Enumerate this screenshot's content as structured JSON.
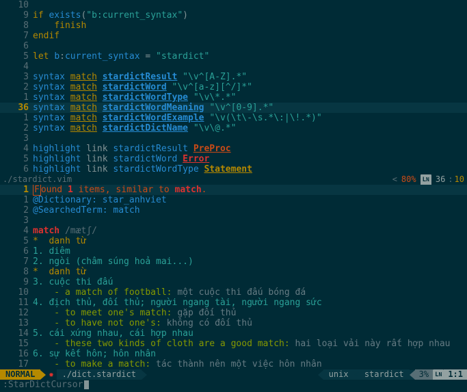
{
  "top_pane": {
    "filename": "./stardict.vim",
    "percent": "80%",
    "line": "36",
    "col": "10",
    "lines": [
      {
        "rel": "10",
        "cur": false,
        "tokens": []
      },
      {
        "rel": "9",
        "cur": false,
        "tokens": [
          {
            "t": "if ",
            "c": "yellow"
          },
          {
            "t": "exists",
            "c": "blue"
          },
          {
            "t": "(",
            "c": "base0"
          },
          {
            "t": "\"b:current_syntax\"",
            "c": "cyan"
          },
          {
            "t": ")",
            "c": "base0"
          }
        ]
      },
      {
        "rel": "8",
        "cur": false,
        "tokens": [
          {
            "t": "    ",
            "c": ""
          },
          {
            "t": "finish",
            "c": "yellow"
          }
        ]
      },
      {
        "rel": "7",
        "cur": false,
        "tokens": [
          {
            "t": "endif",
            "c": "yellow"
          }
        ]
      },
      {
        "rel": "6",
        "cur": false,
        "tokens": []
      },
      {
        "rel": "5",
        "cur": false,
        "tokens": [
          {
            "t": "let ",
            "c": "yellow"
          },
          {
            "t": "b",
            "c": "blue"
          },
          {
            "t": ":",
            "c": "base0"
          },
          {
            "t": "current_syntax ",
            "c": "blue"
          },
          {
            "t": "= ",
            "c": "base0"
          },
          {
            "t": "\"stardict\"",
            "c": "cyan"
          }
        ]
      },
      {
        "rel": "4",
        "cur": false,
        "tokens": []
      },
      {
        "rel": "3",
        "cur": false,
        "tokens": [
          {
            "t": "syntax ",
            "c": "blue"
          },
          {
            "t": "match",
            "c": "yellow ul"
          },
          {
            "t": " ",
            "c": ""
          },
          {
            "t": "stardictResult",
            "c": "blue ul bold"
          },
          {
            "t": " ",
            "c": ""
          },
          {
            "t": "\"\\v^[A-Z].*\"",
            "c": "cyan"
          }
        ]
      },
      {
        "rel": "2",
        "cur": false,
        "tokens": [
          {
            "t": "syntax ",
            "c": "blue"
          },
          {
            "t": "match",
            "c": "yellow ul"
          },
          {
            "t": " ",
            "c": ""
          },
          {
            "t": "stardictWord",
            "c": "blue ul bold"
          },
          {
            "t": " ",
            "c": ""
          },
          {
            "t": "\"\\v^[a-z][^/]*\"",
            "c": "cyan"
          }
        ]
      },
      {
        "rel": "1",
        "cur": false,
        "tokens": [
          {
            "t": "syntax ",
            "c": "blue"
          },
          {
            "t": "match",
            "c": "yellow ul"
          },
          {
            "t": " ",
            "c": ""
          },
          {
            "t": "stardictWordType",
            "c": "blue ul bold"
          },
          {
            "t": " ",
            "c": ""
          },
          {
            "t": "\"\\v\\*.*\"",
            "c": "cyan"
          }
        ]
      },
      {
        "rel": "36",
        "cur": true,
        "tokens": [
          {
            "t": "syntax ",
            "c": "blue"
          },
          {
            "t": "match",
            "c": "yellow ul"
          },
          {
            "t": " ",
            "c": ""
          },
          {
            "t": "stardictWordMeaning",
            "c": "blue ul bold"
          },
          {
            "t": " ",
            "c": ""
          },
          {
            "t": "\"\\v^[0-9].*\"",
            "c": "cyan"
          }
        ]
      },
      {
        "rel": "1",
        "cur": false,
        "tokens": [
          {
            "t": "syntax ",
            "c": "blue"
          },
          {
            "t": "match",
            "c": "yellow ul"
          },
          {
            "t": " ",
            "c": ""
          },
          {
            "t": "stardictWordExample",
            "c": "blue ul bold"
          },
          {
            "t": " ",
            "c": ""
          },
          {
            "t": "\"\\v(\\t\\-\\s.*\\:|\\!.*)\"",
            "c": "cyan"
          }
        ]
      },
      {
        "rel": "2",
        "cur": false,
        "tokens": [
          {
            "t": "syntax ",
            "c": "blue"
          },
          {
            "t": "match",
            "c": "yellow ul"
          },
          {
            "t": " ",
            "c": ""
          },
          {
            "t": "stardictDictName",
            "c": "blue ul bold"
          },
          {
            "t": " ",
            "c": ""
          },
          {
            "t": "\"\\v\\@.*\"",
            "c": "cyan"
          }
        ]
      },
      {
        "rel": "3",
        "cur": false,
        "tokens": []
      },
      {
        "rel": "4",
        "cur": false,
        "tokens": [
          {
            "t": "highlight ",
            "c": "blue"
          },
          {
            "t": "link ",
            "c": "base0"
          },
          {
            "t": "stardictResult ",
            "c": "blue"
          },
          {
            "t": "PreProc",
            "c": "orange ul bold"
          }
        ]
      },
      {
        "rel": "5",
        "cur": false,
        "tokens": [
          {
            "t": "highlight ",
            "c": "blue"
          },
          {
            "t": "link ",
            "c": "base0"
          },
          {
            "t": "stardictWord ",
            "c": "blue"
          },
          {
            "t": "Error",
            "c": "red ul bold"
          }
        ]
      },
      {
        "rel": "6",
        "cur": false,
        "tokens": [
          {
            "t": "highlight ",
            "c": "blue"
          },
          {
            "t": "link ",
            "c": "base0"
          },
          {
            "t": "stardictWordType ",
            "c": "blue"
          },
          {
            "t": "Statement",
            "c": "yellow ul bold"
          }
        ]
      }
    ]
  },
  "bottom_pane": {
    "lines": [
      {
        "rel": "1",
        "cur": true,
        "tokens": [
          {
            "t": "F",
            "c": "orange boxed"
          },
          {
            "t": "ound ",
            "c": "orange"
          },
          {
            "t": "1",
            "c": "red bold"
          },
          {
            "t": " items, similar to ",
            "c": "orange"
          },
          {
            "t": "match",
            "c": "red bold"
          },
          {
            "t": ".",
            "c": "orange"
          }
        ]
      },
      {
        "rel": "1",
        "cur": false,
        "tokens": [
          {
            "t": "@Dictionary: star_anhviet",
            "c": "blue"
          }
        ]
      },
      {
        "rel": "2",
        "cur": false,
        "tokens": [
          {
            "t": "@SearchedTerm: match",
            "c": "blue"
          }
        ]
      },
      {
        "rel": "3",
        "cur": false,
        "tokens": []
      },
      {
        "rel": "4",
        "cur": false,
        "tokens": [
          {
            "t": "match",
            "c": "red bold"
          },
          {
            "t": " /mætʃ/",
            "c": "base01"
          }
        ]
      },
      {
        "rel": "5",
        "cur": false,
        "tokens": [
          {
            "t": "*  danh từ",
            "c": "yellow"
          }
        ]
      },
      {
        "rel": "6",
        "cur": false,
        "tokens": [
          {
            "t": "1. diêm",
            "c": "cyan"
          }
        ]
      },
      {
        "rel": "7",
        "cur": false,
        "tokens": [
          {
            "t": "2. ngòi (châm súng hoả mai...)",
            "c": "cyan"
          }
        ]
      },
      {
        "rel": "8",
        "cur": false,
        "tokens": [
          {
            "t": "*  danh từ",
            "c": "yellow"
          }
        ]
      },
      {
        "rel": "9",
        "cur": false,
        "tokens": [
          {
            "t": "3. cuộc thi đấu",
            "c": "cyan"
          }
        ]
      },
      {
        "rel": "10",
        "cur": false,
        "tokens": [
          {
            "t": "    - a match of football:",
            "c": "green"
          },
          {
            "t": " một cuộc thi đấu bóng đá",
            "c": "base00"
          }
        ]
      },
      {
        "rel": "11",
        "cur": false,
        "tokens": [
          {
            "t": "4. địch thủ, đối thủ; người ngang tài, người ngang sức",
            "c": "cyan"
          }
        ]
      },
      {
        "rel": "12",
        "cur": false,
        "tokens": [
          {
            "t": "    - to meet one's match:",
            "c": "green"
          },
          {
            "t": " gặp đối thủ",
            "c": "base00"
          }
        ]
      },
      {
        "rel": "13",
        "cur": false,
        "tokens": [
          {
            "t": "    - to have not one's:",
            "c": "green"
          },
          {
            "t": " không có đối thủ",
            "c": "base00"
          }
        ]
      },
      {
        "rel": "14",
        "cur": false,
        "tokens": [
          {
            "t": "5. cái xứng nhau, cái hợp nhau",
            "c": "cyan"
          }
        ]
      },
      {
        "rel": "15",
        "cur": false,
        "tokens": [
          {
            "t": "    - these two kinds of cloth are a good match:",
            "c": "green"
          },
          {
            "t": " hai loại vải này rất hợp nhau",
            "c": "base00"
          }
        ]
      },
      {
        "rel": "16",
        "cur": false,
        "tokens": [
          {
            "t": "6. sự kết hôn; hôn nhân",
            "c": "cyan"
          }
        ]
      },
      {
        "rel": "17",
        "cur": false,
        "tokens": [
          {
            "t": "    - to make a match:",
            "c": "green"
          },
          {
            "t": " tác thành nên một việc hôn nhân",
            "c": "base00"
          }
        ]
      }
    ]
  },
  "status": {
    "mode": "NORMAL",
    "branch_icon": "",
    "flag": "✹",
    "file": "./dict.stardict",
    "encoding": "unix",
    "filetype": "stardict",
    "percent": "3%",
    "pos": "1:1"
  },
  "cmdline": ":StarDictCursor"
}
